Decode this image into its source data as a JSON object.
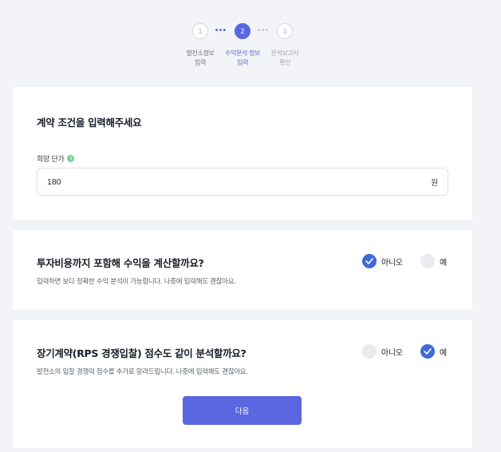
{
  "stepper": {
    "steps": [
      {
        "number": "1",
        "label_line1": "발전소정보",
        "label_line2": "입력",
        "state": "done"
      },
      {
        "number": "2",
        "label_line1": "수익분석 정보",
        "label_line2": "입력",
        "state": "active"
      },
      {
        "number": "3",
        "label_line1": "분석보고서",
        "label_line2": "확인",
        "state": "todo"
      }
    ],
    "dots": "•••"
  },
  "contract": {
    "title": "계약 조건을 입력해주세요",
    "field_label": "희망 단가",
    "info_icon": "info-icon",
    "value": "180",
    "unit": "원"
  },
  "investment": {
    "question": "투자비용까지 포함해 수익을 계산할까요?",
    "description": "입력하면 보다 정확한 수익 분석이 가능합니다. 나중에 입력해도 괜찮아요.",
    "option_no": "아니오",
    "option_yes": "예",
    "selected": "no"
  },
  "long_term": {
    "question": "장기계약(RPS 경쟁입찰) 점수도 같이 분석할까요?",
    "description": "발전소의 입찰 경쟁력 점수를 추가로 알려드립니다. 나중에 입력해도 괜찮아요.",
    "option_no": "아니오",
    "option_yes": "예",
    "selected": "yes"
  },
  "next_button": "다음",
  "colors": {
    "accent": "#5a67e0",
    "check_blue": "#3f6bd8",
    "background": "#f2f4f8",
    "info_green": "#7ccf9a"
  }
}
